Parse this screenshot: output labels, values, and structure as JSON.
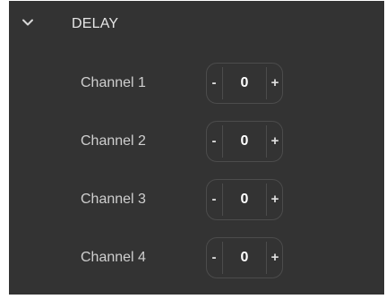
{
  "section": {
    "title": "DELAY",
    "expanded": true,
    "icon": "chevron-down-icon"
  },
  "channels": [
    {
      "label": "Channel 1",
      "value": "0",
      "minus": "-",
      "plus": "+"
    },
    {
      "label": "Channel 2",
      "value": "0",
      "minus": "-",
      "plus": "+"
    },
    {
      "label": "Channel 3",
      "value": "0",
      "minus": "-",
      "plus": "+"
    },
    {
      "label": "Channel 4",
      "value": "0",
      "minus": "-",
      "plus": "+"
    }
  ],
  "colors": {
    "panel_bg": "#333333",
    "stepper_border": "#4c4c4c",
    "text": "#cfcfcf",
    "value_text": "#ffffff"
  }
}
